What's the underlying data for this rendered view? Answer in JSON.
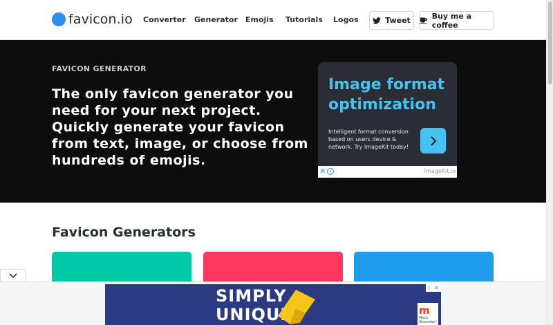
{
  "header": {
    "logo_text": "favicon.io",
    "logo_color": "#2d8ff0",
    "nav": [
      "Converter",
      "Generator",
      "Emojis",
      "Tutorials",
      "Logos"
    ],
    "tweet_label": "Tweet",
    "coffee_label": "Buy me a coffee"
  },
  "hero": {
    "eyebrow": "FAVICON GENERATOR",
    "headline": "The only favicon generator you need for your next project. Quickly generate your favicon from text, image, or choose from hundreds of emojis.",
    "background": "#0d0d0d"
  },
  "ad": {
    "title": "Image format optimization",
    "body": "Intelligent format conversion based on users device & network. Try ImageKit today!",
    "brand": "ImageKit.io",
    "close": "✕",
    "info": "i",
    "accent": "#45c2f2"
  },
  "section": {
    "title": "Favicon Generators",
    "cards": [
      {
        "color": "#00c9a7"
      },
      {
        "color": "#ff3860"
      },
      {
        "color": "#209cee"
      }
    ]
  },
  "bottom_ad": {
    "text_line1": "SIMPLY",
    "text_line2": "UNIQUE",
    "logo_mark": "m",
    "logo_text": "Meza Stavelder!",
    "close": "✕",
    "info": "i"
  },
  "icons": [
    "twitter-icon",
    "coffee-icon",
    "chevron-right-icon",
    "chevron-down-icon",
    "close-icon",
    "info-icon"
  ]
}
